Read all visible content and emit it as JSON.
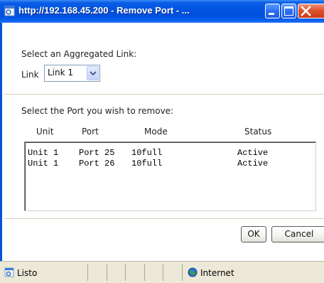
{
  "window": {
    "title": "http://192.168.45.200 - Remove Port - ...",
    "icon": "ie-page-icon"
  },
  "form": {
    "aggregated_heading": "Select an Aggregated Link:",
    "link_label": "Link",
    "link_value": "Link 1",
    "port_heading": "Select the Port you wish to remove:"
  },
  "table": {
    "columns": [
      "Unit",
      "Port",
      "Mode",
      "Status"
    ],
    "rows": [
      [
        "Unit 1",
        "Port 25",
        "10full",
        "Active"
      ],
      [
        "Unit 1",
        "Port 26",
        "10full",
        "Active"
      ]
    ]
  },
  "buttons": {
    "ok": "OK",
    "cancel": "Cancel"
  },
  "statusbar": {
    "status_text": "Listo",
    "zone_text": "Internet"
  }
}
